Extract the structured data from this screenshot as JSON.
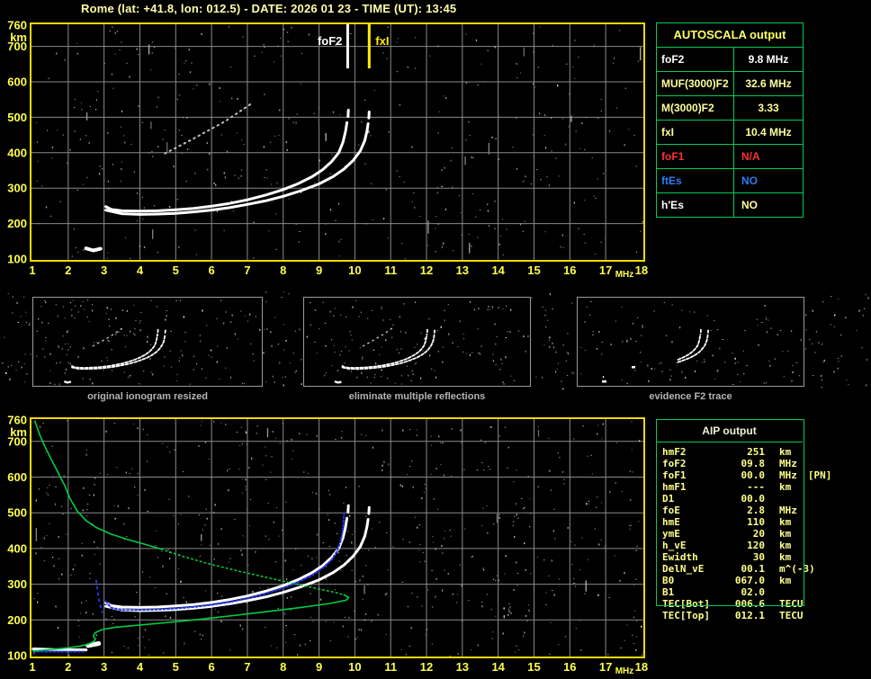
{
  "header": {
    "title": "Rome (lat: +41.8, lon: 012.5) - DATE: 2026 01 23 - TIME (UT): 13:45"
  },
  "autoscala": {
    "title": "AUTOSCALA output",
    "rows": [
      {
        "label": "foF2",
        "value": "9.8 MHz",
        "label_color": "#ffffff",
        "value_color": "#ffffff",
        "align": "center"
      },
      {
        "label": "MUF(3000)F2",
        "value": "32.6 MHz",
        "label_color": "#ffff9c",
        "value_color": "#ffff9c",
        "align": "center"
      },
      {
        "label": "M(3000)F2",
        "value": "3.33",
        "label_color": "#ffff9c",
        "value_color": "#ffff9c",
        "align": "center"
      },
      {
        "label": "fxI",
        "value": "10.4 MHz",
        "label_color": "#ffff9c",
        "value_color": "#ffff9c",
        "align": "center"
      },
      {
        "label": "foF1",
        "value": "N/A",
        "label_color": "#ff3030",
        "value_color": "#ff3030",
        "align": "left"
      },
      {
        "label": "ftEs",
        "value": "NO",
        "label_color": "#2f7df0",
        "value_color": "#2f7df0",
        "align": "left"
      },
      {
        "label": "h'Es",
        "value": "NO",
        "label_color": "#ffffff",
        "value_color": "#ffff9c",
        "align": "left"
      }
    ]
  },
  "aip": {
    "title": "AIP output",
    "rows": [
      {
        "label": "hmF2",
        "value": "251",
        "unit": "km",
        "extra": ""
      },
      {
        "label": "foF2",
        "value": "09.8",
        "unit": "MHz",
        "extra": ""
      },
      {
        "label": "foF1",
        "value": "00.0",
        "unit": "MHz",
        "extra": "[PN]"
      },
      {
        "label": "hmF1",
        "value": "---",
        "unit": "km",
        "extra": ""
      },
      {
        "label": "D1",
        "value": "00.0",
        "unit": "",
        "extra": ""
      },
      {
        "label": "foE",
        "value": "2.8",
        "unit": "MHz",
        "extra": ""
      },
      {
        "label": "hmE",
        "value": "110",
        "unit": "km",
        "extra": ""
      },
      {
        "label": "ymE",
        "value": "20",
        "unit": "km",
        "extra": ""
      },
      {
        "label": "h_vE",
        "value": "120",
        "unit": "km",
        "extra": ""
      },
      {
        "label": "Ewidth",
        "value": "30",
        "unit": "km",
        "extra": ""
      },
      {
        "label": "DelN_vE",
        "value": "00.1",
        "unit": "m^(-3)",
        "extra": ""
      },
      {
        "label": "B0",
        "value": "067.0",
        "unit": "km",
        "extra": ""
      },
      {
        "label": "B1",
        "value": "02.0",
        "unit": "",
        "extra": ""
      },
      {
        "label": "TEC[Bot]",
        "value": "006.6",
        "unit": "TECU",
        "extra": ""
      },
      {
        "label": "TEC[Top]",
        "value": "012.1",
        "unit": "TECU",
        "extra": ""
      }
    ]
  },
  "thumbnails": [
    {
      "caption": "original ionogram resized"
    },
    {
      "caption": "eliminate multiple reflections"
    },
    {
      "caption": "evidence F2 trace"
    }
  ],
  "chart_data": [
    {
      "name": "top-ionogram",
      "type": "scatter",
      "xlabel": "MHz",
      "ylabel": "km",
      "xlim": [
        1,
        18
      ],
      "ylim": [
        100,
        760
      ],
      "x_ticks": [
        1,
        2,
        3,
        4,
        5,
        6,
        7,
        8,
        9,
        10,
        11,
        12,
        13,
        14,
        15,
        16,
        17,
        18
      ],
      "y_ticks": [
        760,
        700,
        600,
        500,
        400,
        300,
        200,
        100
      ],
      "grid": true,
      "markers": [
        {
          "label": "foF2",
          "x": 9.8,
          "color": "#ffffff",
          "side": "left"
        },
        {
          "label": "fxI",
          "x": 10.4,
          "color": "#ffee00",
          "side": "right"
        }
      ],
      "series": [
        {
          "name": "o-trace",
          "color": "#ffffff",
          "width": 3,
          "dash": "",
          "points": [
            [
              3.05,
              248
            ],
            [
              3.2,
              240
            ],
            [
              3.5,
              236
            ],
            [
              4.0,
              235
            ],
            [
              4.5,
              236
            ],
            [
              5.0,
              239
            ],
            [
              5.5,
              243
            ],
            [
              6.0,
              249
            ],
            [
              6.5,
              257
            ],
            [
              7.0,
              267
            ],
            [
              7.5,
              280
            ],
            [
              8.0,
              296
            ],
            [
              8.4,
              312
            ],
            [
              8.8,
              332
            ],
            [
              9.1,
              352
            ],
            [
              9.35,
              375
            ],
            [
              9.55,
              400
            ],
            [
              9.67,
              430
            ],
            [
              9.74,
              460
            ],
            [
              9.78,
              485
            ]
          ]
        },
        {
          "name": "o-trace-tip",
          "color": "#ffffff",
          "width": 3,
          "dash": "",
          "points": [
            [
              9.81,
              502
            ],
            [
              9.82,
              520
            ]
          ]
        },
        {
          "name": "x-trace",
          "color": "#ffffff",
          "width": 3,
          "dash": "",
          "points": [
            [
              3.05,
              238
            ],
            [
              3.5,
              228
            ],
            [
              4.0,
              226
            ],
            [
              4.5,
              227
            ],
            [
              5.0,
              229
            ],
            [
              5.5,
              233
            ],
            [
              6.0,
              238
            ],
            [
              6.5,
              245
            ],
            [
              7.0,
              254
            ],
            [
              7.5,
              264
            ],
            [
              8.0,
              277
            ],
            [
              8.5,
              293
            ],
            [
              9.0,
              312
            ],
            [
              9.4,
              333
            ],
            [
              9.7,
              354
            ],
            [
              9.95,
              378
            ],
            [
              10.15,
              405
            ],
            [
              10.28,
              435
            ],
            [
              10.34,
              462
            ],
            [
              10.37,
              482
            ]
          ]
        },
        {
          "name": "x-trace-tip",
          "color": "#ffffff",
          "width": 3,
          "dash": "",
          "points": [
            [
              10.39,
              498
            ],
            [
              10.4,
              515
            ]
          ]
        },
        {
          "name": "e-echo-blob",
          "color": "#ffffff",
          "width": 4,
          "dash": "",
          "points": [
            [
              2.5,
              130
            ],
            [
              2.7,
              124
            ],
            [
              2.9,
              129
            ]
          ]
        },
        {
          "name": "multiple-reflection-streak",
          "color": "#bfbfbf",
          "width": 2,
          "dash": "1.5 4.5",
          "points": [
            [
              4.7,
              398
            ],
            [
              5.5,
              440
            ],
            [
              6.4,
              490
            ],
            [
              7.1,
              538
            ]
          ]
        }
      ]
    },
    {
      "name": "bottom-ionogram-with-profile",
      "type": "scatter",
      "xlabel": "MHz",
      "ylabel": "km",
      "xlim": [
        1,
        18
      ],
      "ylim": [
        100,
        760
      ],
      "x_ticks": [
        1,
        2,
        3,
        4,
        5,
        6,
        7,
        8,
        9,
        10,
        11,
        12,
        13,
        14,
        15,
        16,
        17,
        18
      ],
      "y_ticks": [
        760,
        700,
        600,
        500,
        400,
        300,
        200,
        100
      ],
      "grid": true,
      "markers": [],
      "series": [
        {
          "name": "o-trace",
          "color": "#ffffff",
          "width": 3,
          "dash": "",
          "points": [
            [
              3.05,
              248
            ],
            [
              3.2,
              240
            ],
            [
              3.5,
              236
            ],
            [
              4.0,
              235
            ],
            [
              4.5,
              236
            ],
            [
              5.0,
              239
            ],
            [
              5.5,
              243
            ],
            [
              6.0,
              249
            ],
            [
              6.5,
              257
            ],
            [
              7.0,
              267
            ],
            [
              7.5,
              280
            ],
            [
              8.0,
              296
            ],
            [
              8.4,
              312
            ],
            [
              8.8,
              332
            ],
            [
              9.1,
              352
            ],
            [
              9.35,
              375
            ],
            [
              9.55,
              400
            ],
            [
              9.67,
              430
            ],
            [
              9.74,
              460
            ],
            [
              9.78,
              485
            ]
          ]
        },
        {
          "name": "o-trace-tip",
          "color": "#ffffff",
          "width": 3,
          "dash": "",
          "points": [
            [
              9.81,
              502
            ],
            [
              9.82,
              520
            ]
          ]
        },
        {
          "name": "x-trace",
          "color": "#ffffff",
          "width": 3,
          "dash": "",
          "points": [
            [
              3.05,
              238
            ],
            [
              3.5,
              228
            ],
            [
              4.0,
              226
            ],
            [
              4.5,
              227
            ],
            [
              5.0,
              229
            ],
            [
              5.5,
              233
            ],
            [
              6.0,
              238
            ],
            [
              6.5,
              245
            ],
            [
              7.0,
              254
            ],
            [
              7.5,
              264
            ],
            [
              8.0,
              277
            ],
            [
              8.5,
              293
            ],
            [
              9.0,
              312
            ],
            [
              9.4,
              333
            ],
            [
              9.7,
              354
            ],
            [
              9.95,
              378
            ],
            [
              10.15,
              405
            ],
            [
              10.28,
              435
            ],
            [
              10.34,
              462
            ],
            [
              10.37,
              482
            ]
          ]
        },
        {
          "name": "x-trace-tip",
          "color": "#ffffff",
          "width": 3,
          "dash": "",
          "points": [
            [
              10.39,
              498
            ],
            [
              10.4,
              515
            ]
          ]
        },
        {
          "name": "e-echo",
          "color": "#ffffff",
          "width": 3,
          "dash": "",
          "points": [
            [
              1.02,
              119
            ],
            [
              1.6,
              117
            ],
            [
              2.5,
              116
            ]
          ]
        },
        {
          "name": "e-echo-blob",
          "color": "#ffffff",
          "width": 5,
          "dash": "",
          "points": [
            [
              2.55,
              128
            ],
            [
              2.85,
              134
            ]
          ]
        },
        {
          "name": "restored-trace-e",
          "color": "#2236f0",
          "width": 2,
          "dash": "2 2.5",
          "points": [
            [
              1.02,
              111
            ],
            [
              2.45,
              111
            ]
          ]
        },
        {
          "name": "restored-trace-step",
          "color": "#2236f0",
          "width": 2,
          "dash": "2 5",
          "points": [
            [
              2.78,
              310
            ],
            [
              2.82,
              280
            ],
            [
              2.87,
              250
            ],
            [
              2.95,
              222
            ]
          ]
        },
        {
          "name": "restored-trace-f",
          "color": "#2236f0",
          "width": 2,
          "dash": "2 2.5",
          "points": [
            [
              3.05,
              252
            ],
            [
              3.2,
              234
            ],
            [
              3.5,
              228
            ],
            [
              4.0,
              228
            ],
            [
              4.5,
              229
            ],
            [
              5.0,
              232
            ],
            [
              5.5,
              236
            ],
            [
              6.0,
              242
            ],
            [
              6.5,
              250
            ],
            [
              7.0,
              260
            ],
            [
              7.5,
              273
            ],
            [
              8.0,
              289
            ],
            [
              8.4,
              305
            ],
            [
              8.8,
              325
            ],
            [
              9.1,
              345
            ],
            [
              9.35,
              368
            ],
            [
              9.5,
              392
            ],
            [
              9.6,
              420
            ],
            [
              9.67,
              455
            ],
            [
              9.7,
              500
            ]
          ]
        },
        {
          "name": "density-profile-topside",
          "color": "#00cc44",
          "width": 1.6,
          "dash": "",
          "points": [
            [
              1.07,
              757
            ],
            [
              1.18,
              725
            ],
            [
              1.32,
              692
            ],
            [
              1.5,
              655
            ],
            [
              1.7,
              616
            ],
            [
              1.9,
              577
            ],
            [
              2.05,
              540
            ],
            [
              2.25,
              505
            ],
            [
              2.5,
              478
            ],
            [
              2.8,
              458
            ],
            [
              3.2,
              440
            ],
            [
              3.7,
              424
            ],
            [
              4.2,
              410
            ],
            [
              4.6,
              398
            ]
          ]
        },
        {
          "name": "density-profile-dotted",
          "color": "#00cc44",
          "width": 1.6,
          "dash": "1.5 3.5",
          "points": [
            [
              4.6,
              398
            ],
            [
              5.2,
              378
            ],
            [
              5.9,
              358
            ],
            [
              6.7,
              338
            ],
            [
              7.5,
              320
            ],
            [
              8.2,
              304
            ],
            [
              8.8,
              291
            ],
            [
              9.4,
              278
            ],
            [
              9.7,
              270
            ]
          ]
        },
        {
          "name": "density-profile-bottomside",
          "color": "#00cc44",
          "width": 1.6,
          "dash": "",
          "points": [
            [
              9.7,
              270
            ],
            [
              9.83,
              263
            ],
            [
              9.75,
              255
            ],
            [
              9.3,
              246
            ],
            [
              8.5,
              235
            ],
            [
              7.6,
              224
            ],
            [
              6.6,
              212
            ],
            [
              5.6,
              201
            ],
            [
              4.7,
              192
            ],
            [
              3.9,
              185
            ],
            [
              3.3,
              179
            ],
            [
              2.95,
              173
            ],
            [
              2.75,
              164
            ],
            [
              2.7,
              154
            ],
            [
              2.76,
              147
            ],
            [
              2.72,
              140
            ],
            [
              2.55,
              132
            ],
            [
              2.3,
              126
            ],
            [
              2.0,
              122
            ],
            [
              1.6,
              118
            ],
            [
              1.15,
              114
            ],
            [
              1.02,
              113
            ]
          ]
        }
      ]
    }
  ]
}
